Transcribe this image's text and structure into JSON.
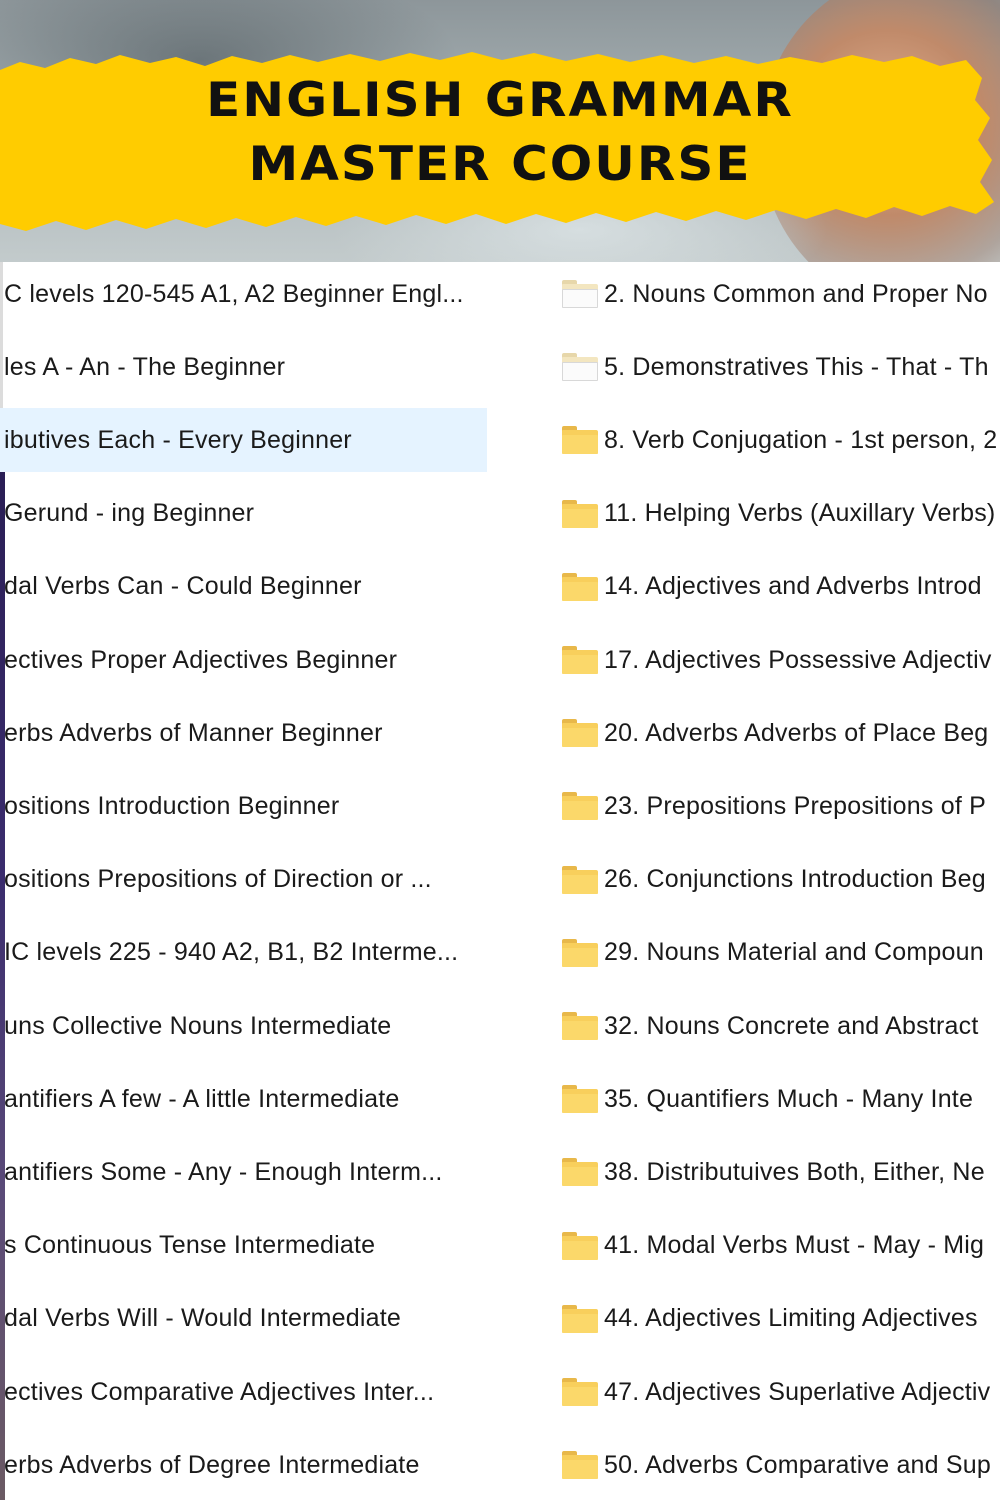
{
  "banner": {
    "title_line1": "ENGLISH GRAMMAR",
    "title_line2": "MASTER COURSE",
    "colors": {
      "banner_yellow": "#ffcc00",
      "title_text": "#111111"
    }
  },
  "explorer": {
    "left_column": [
      "C levels 120-545  A1, A2  Beginner Engl...",
      "les  A - An - The  Beginner",
      "ibutives  Each - Every  Beginner",
      " Gerund - ing  Beginner",
      "dal Verbs   Can - Could  Beginner",
      "ectives  Proper Adjectives Beginner",
      "erbs  Adverbs of Manner  Beginner",
      "ositions  Introduction  Beginner",
      "ositions  Prepositions of Direction or ...",
      "IC levels 225 - 940  A2, B1, B2  Interme...",
      "uns  Collective Nouns  Intermediate",
      "antifiers  A few - A little  Intermediate",
      "antifiers  Some - Any - Enough  Interm...",
      "s  Continuous Tense  Intermediate",
      "dal Verbs  Will - Would  Intermediate",
      "ectives  Comparative Adjectives  Inter...",
      "erbs  Adverbs of Degree  Intermediate"
    ],
    "selected_left_index": 2,
    "right_column": [
      {
        "label": "2. Nouns  Common and Proper No",
        "icon": "folder-empty-icon"
      },
      {
        "label": "5. Demonstratives  This - That - Th",
        "icon": "folder-empty-icon"
      },
      {
        "label": "8. Verb Conjugation - 1st person, 2",
        "icon": "folder-icon"
      },
      {
        "label": "11. Helping Verbs (Auxillary Verbs)",
        "icon": "folder-icon"
      },
      {
        "label": "14. Adjectives and  Adverbs  Introd",
        "icon": "folder-icon"
      },
      {
        "label": "17. Adjectives  Possessive Adjectiv",
        "icon": "folder-icon"
      },
      {
        "label": "20. Adverbs  Adverbs of Place  Beg",
        "icon": "folder-icon"
      },
      {
        "label": "23. Prepositions  Prepositions of P",
        "icon": "folder-icon"
      },
      {
        "label": "26. Conjunctions  Introduction Beg",
        "icon": "folder-icon"
      },
      {
        "label": "29. Nouns  Material and Compoun",
        "icon": "folder-icon"
      },
      {
        "label": "32. Nouns  Concrete and Abstract",
        "icon": "folder-icon"
      },
      {
        "label": "35. Quantifiers  Much - Many  Inte",
        "icon": "folder-icon"
      },
      {
        "label": "38. Distributuives  Both, Either, Ne",
        "icon": "folder-icon"
      },
      {
        "label": "41. Modal Verbs  Must - May - Mig",
        "icon": "folder-icon"
      },
      {
        "label": "44. Adjectives  Limiting Adjectives",
        "icon": "folder-icon"
      },
      {
        "label": "47. Adjectives  Superlative Adjectiv",
        "icon": "folder-icon"
      },
      {
        "label": "50. Adverbs  Comparative and Sup",
        "icon": "folder-icon"
      }
    ],
    "colors": {
      "selection": "#e5f3ff",
      "folder": "#f8cf5c",
      "text": "#1a1a1a"
    }
  }
}
